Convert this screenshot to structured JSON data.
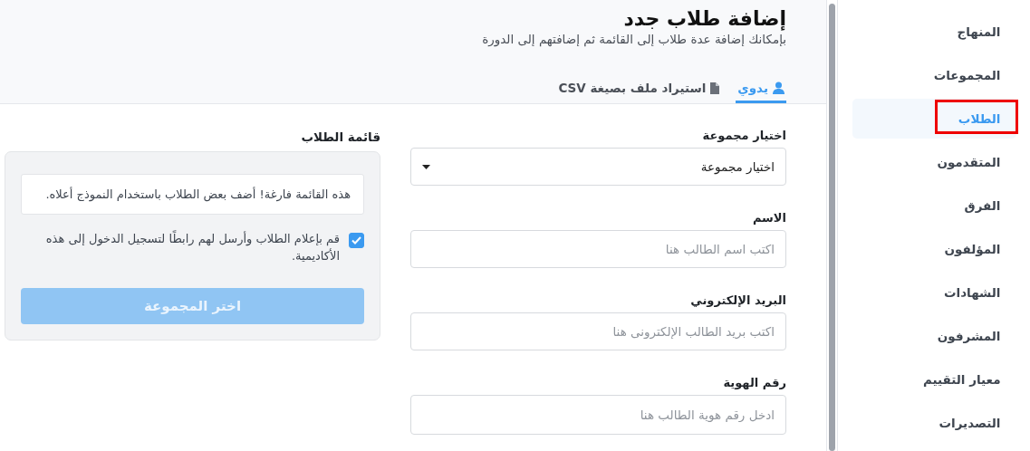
{
  "header": {
    "title": "إضافة طلاب جدد",
    "subtitle": "بإمكانك إضافة عدة طلاب إلى القائمة ثم إضافتهم إلى الدورة"
  },
  "tabs": [
    {
      "label": "يدوي",
      "kind": "user",
      "selected": true
    },
    {
      "label": "استيراد ملف بصيغة CSV",
      "kind": "file",
      "selected": false
    }
  ],
  "form": {
    "fields": [
      {
        "kind": "select",
        "label": "اختيار مجموعة",
        "value": "اختيار مجموعة"
      },
      {
        "kind": "text",
        "label": "الاسم",
        "placeholder": "اكتب اسم الطالب هنا"
      },
      {
        "kind": "text",
        "label": "البريد الإلكتروني",
        "placeholder": "اكتب بريد الطالب الإلكترونى هنا"
      },
      {
        "kind": "text",
        "label": "رقم الهوية",
        "placeholder": "ادخل رقم هوية الطالب هنا"
      }
    ]
  },
  "student_list": {
    "title": "قائمة الطلاب",
    "empty_message": "هذه القائمة فارغة! أضف بعض الطلاب باستخدام النموذج أعلاه.",
    "notify": {
      "label": "قم بإعلام الطلاب وأرسل لهم رابطًا لتسجيل الدخول إلى هذه الأكاديمية.",
      "checked": true
    },
    "button": {
      "label": "اختر المجموعة",
      "disabled": true
    }
  },
  "sidebar": {
    "items": [
      {
        "label": "المنهاج",
        "selected": false,
        "highlighted": false
      },
      {
        "label": "المجموعات",
        "selected": false,
        "highlighted": false
      },
      {
        "label": "الطلاب",
        "selected": true,
        "highlighted": true
      },
      {
        "label": "المتقدمون",
        "selected": false,
        "highlighted": false
      },
      {
        "label": "الفرق",
        "selected": false,
        "highlighted": false
      },
      {
        "label": "المؤلفون",
        "selected": false,
        "highlighted": false
      },
      {
        "label": "الشهادات",
        "selected": false,
        "highlighted": false
      },
      {
        "label": "المشرفون",
        "selected": false,
        "highlighted": false
      },
      {
        "label": "معيار التقييم",
        "selected": false,
        "highlighted": false
      },
      {
        "label": "التصديرات",
        "selected": false,
        "highlighted": false
      }
    ]
  }
}
